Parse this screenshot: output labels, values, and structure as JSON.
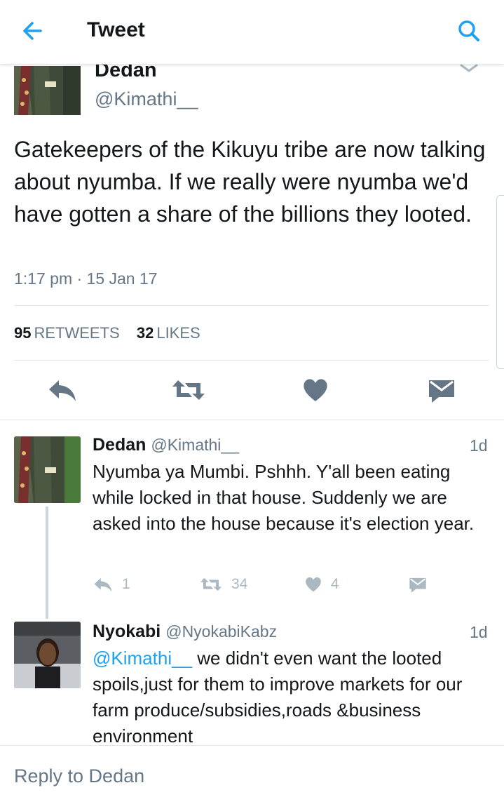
{
  "header": {
    "title": "Tweet"
  },
  "tweet": {
    "name": "Dedan",
    "handle": "@Kimathi__",
    "text": "Gatekeepers of the Kikuyu tribe are now talking about nyumba. If we really were nyumba we'd have gotten a share of the billions they looted.",
    "timestamp": "1:17 pm · 15 Jan 17",
    "retweet_count": "95",
    "retweet_label": "RETWEETS",
    "like_count": "32",
    "like_label": "LIKES"
  },
  "replies": [
    {
      "name": "Dedan",
      "handle": "@Kimathi__",
      "time": "1d",
      "text": "Nyumba ya Mumbi. Pshhh. Y'all been eating while locked in that house. Suddenly we are asked into the house because it's election year.",
      "reply_count": "1",
      "retweet_count": "34",
      "like_count": "4"
    },
    {
      "name": "Nyokabi",
      "handle": "@NyokabiKabz",
      "time": "1d",
      "mention": "@Kimathi__",
      "text": " we didn't even want the looted spoils,just for them to improve markets for our farm produce/subsidies,roads &business environment"
    }
  ],
  "compose": {
    "placeholder": "Reply to Dedan"
  },
  "colors": {
    "accent": "#1da1f2",
    "icon_dark": "#657786",
    "icon_light": "#aab8c2"
  },
  "icons": [
    "back-arrow",
    "search",
    "caret-down",
    "reply",
    "retweet",
    "heart",
    "direct-message"
  ]
}
